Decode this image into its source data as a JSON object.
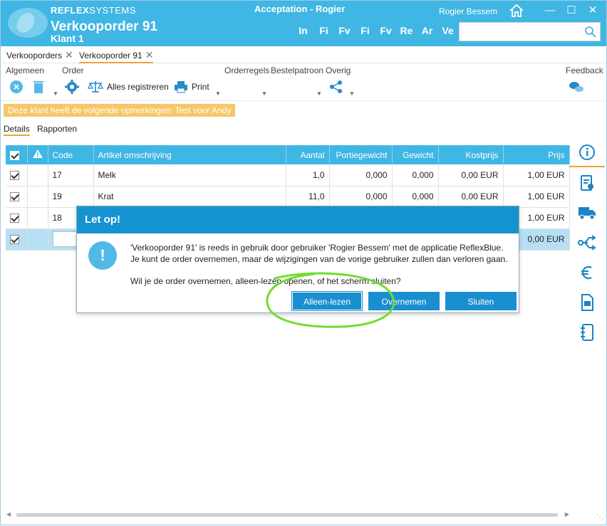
{
  "header": {
    "logo_bold": "REFLEX",
    "logo_thin": "SYSTEMS",
    "title": "Verkooporder 91",
    "subtitle": "Klant 1",
    "app_title": "Acceptation - Rogier",
    "user": "Rogier Bessem",
    "nav": [
      "In",
      "Fi",
      "Fv",
      "Fi",
      "Fv",
      "Re",
      "Ar",
      "Ve"
    ],
    "search_placeholder": ""
  },
  "tabs": [
    {
      "label": "Verkooporders"
    },
    {
      "label": "Verkooporder 91"
    }
  ],
  "ribbon": {
    "groups": [
      "Algemeen",
      "Order",
      "Orderregels",
      "Bestelpatroon",
      "Overig",
      "Feedback"
    ],
    "register_label": "Alles registreren",
    "print_label": "Print"
  },
  "notice": "Deze klant heeft de volgende opmerkingen: Test voor Andy",
  "subtabs": [
    "Details",
    "Rapporten"
  ],
  "grid": {
    "columns": [
      "Code",
      "Artikel omschrijving",
      "Aantal",
      "Portiegewicht",
      "Gewicht",
      "Kostprijs",
      "Prijs"
    ],
    "rows": [
      {
        "code": "17",
        "desc": "Melk",
        "aantal": "1,0",
        "portie": "0,000",
        "gewicht": "0,000",
        "kost": "0,00 EUR",
        "prijs": "1,00 EUR"
      },
      {
        "code": "19",
        "desc": "Krat",
        "aantal": "11,0",
        "portie": "0,000",
        "gewicht": "0,000",
        "kost": "0,00 EUR",
        "prijs": "1,00 EUR"
      },
      {
        "code": "18",
        "desc": "",
        "aantal": "",
        "portie": "",
        "gewicht": "",
        "kost": "",
        "prijs": "1,00 EUR"
      },
      {
        "code": "",
        "desc": "",
        "aantal": "",
        "portie": "",
        "gewicht": "",
        "kost": "",
        "prijs": "0,00 EUR"
      }
    ]
  },
  "dialog": {
    "title": "Let op!",
    "icon": "!",
    "line1": "'Verkooporder 91' is reeds in gebruik door gebruiker 'Rogier Bessem' met de applicatie ReflexBlue.",
    "line2": "Je kunt de order overnemen, maar de wijzigingen van de vorige gebruiker zullen dan verloren gaan.",
    "question": "Wil je de order overnemen, alleen-lezen openen, of het scherm sluiten?",
    "buttons": [
      "Alleen-lezen",
      "Overnemen",
      "Sluiten"
    ]
  },
  "colors": {
    "header": "#3fb6e3",
    "dialog_header": "#1593d0",
    "button": "#1a8fd0",
    "notice": "#f6c768",
    "accent_underline": "#f0a23a",
    "annotation": "#6fdc2e"
  }
}
